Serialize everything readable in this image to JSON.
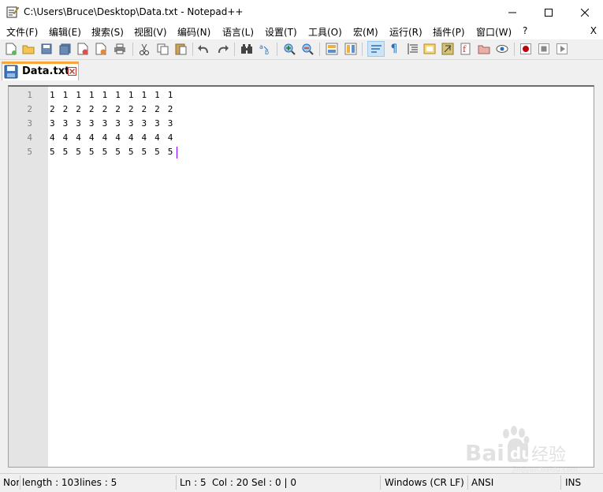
{
  "window": {
    "title": "C:\\Users\\Bruce\\Desktop\\Data.txt - Notepad++"
  },
  "menu": {
    "items": [
      "文件(F)",
      "编辑(E)",
      "搜索(S)",
      "视图(V)",
      "编码(N)",
      "语言(L)",
      "设置(T)",
      "工具(O)",
      "宏(M)",
      "运行(R)",
      "插件(P)",
      "窗口(W)",
      "?"
    ],
    "close_label": "X"
  },
  "toolbar": {
    "icons": [
      "new-file-icon",
      "open-file-icon",
      "save-icon",
      "save-all-icon",
      "close-icon",
      "close-all-icon",
      "print-icon",
      "cut-icon",
      "copy-icon",
      "paste-icon",
      "undo-icon",
      "redo-icon",
      "find-icon",
      "replace-icon",
      "zoom-in-icon",
      "zoom-out-icon",
      "sync-vertical-icon",
      "sync-horizontal-icon",
      "word-wrap-icon",
      "show-all-characters-icon",
      "indent-guide-icon",
      "document-map-icon",
      "function-list-icon",
      "folder-as-workspace-icon",
      "monitoring-icon",
      "record-macro-icon",
      "stop-macro-icon",
      "play-macro-icon"
    ]
  },
  "tab": {
    "label": "Data.txt"
  },
  "editor": {
    "line_numbers": [
      "1",
      "2",
      "3",
      "4",
      "5"
    ],
    "lines": [
      "1 1 1 1 1 1 1 1 1 1",
      "2 2 2 2 2 2 2 2 2 2",
      "3 3 3 3 3 3 3 3 3 3",
      "4 4 4 4 4 4 4 4 4 4",
      "5 5 5 5 5 5 5 5 5 5"
    ]
  },
  "status": {
    "type": "Nor",
    "length": "length : 103",
    "lines": "lines : 5",
    "ln": "Ln : 5",
    "col": "Col : 20",
    "sel": "Sel : 0 | 0",
    "eol": "Windows (CR LF)",
    "encoding": "ANSI",
    "mode": "INS"
  },
  "colors": {
    "tab_accent": "#faa53a",
    "caret": "#8000ff",
    "gutter": "#e4e4e4",
    "line_number": "#808080"
  }
}
